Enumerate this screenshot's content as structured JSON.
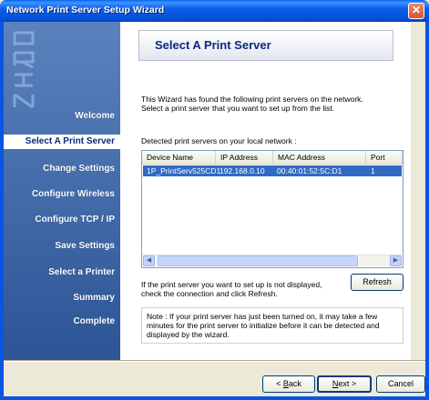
{
  "window": {
    "title": "Network Print Server Setup Wizard"
  },
  "sidebar": {
    "logo_text": "PRIN",
    "items": [
      {
        "label": "Welcome",
        "active": false
      },
      {
        "label": "Select A Print Server",
        "active": true
      },
      {
        "label": "Change Settings",
        "active": false
      },
      {
        "label": "Configure Wireless",
        "active": false
      },
      {
        "label": "Configure TCP / IP",
        "active": false
      },
      {
        "label": "Save Settings",
        "active": false
      },
      {
        "label": "Select a Printer",
        "active": false
      },
      {
        "label": "Summary",
        "active": false
      },
      {
        "label": "Complete",
        "active": false
      }
    ]
  },
  "page": {
    "title": "Select A Print Server",
    "intro_line1": "This Wizard has found the following print servers on the network.",
    "intro_line2": "Select a print server that you want to set up from the list.",
    "list_label": "Detected print servers on your local network :"
  },
  "servers": {
    "columns": [
      "Device Name",
      "IP Address",
      "MAC Address",
      "Port"
    ],
    "rows": [
      {
        "device": "1P_PrintServ525CD1",
        "ip": "192.168.0.10",
        "mac": "00:40:01:52:5C:D1",
        "port": "1",
        "selected": true
      }
    ]
  },
  "refresh": {
    "hint_line1": "If the print server you want to set up is not displayed,",
    "hint_line2": "check the connection and click Refresh.",
    "button_label": "Refresh"
  },
  "note": {
    "line1": "Note : If your print server has just been turned on, it may take a few",
    "line2": "minutes for the print server to initialize before it can be detected and",
    "line3": "displayed by the wizard."
  },
  "footer": {
    "back_prefix": "< ",
    "back_key": "B",
    "back_rest": "ack",
    "next_key": "N",
    "next_rest": "ext >",
    "cancel_label": "Cancel"
  },
  "colors": {
    "titlebar": "#0a5ee8",
    "sidebar": "#4a72b2",
    "selection": "#316ac5",
    "header_title": "#0b2a80"
  }
}
